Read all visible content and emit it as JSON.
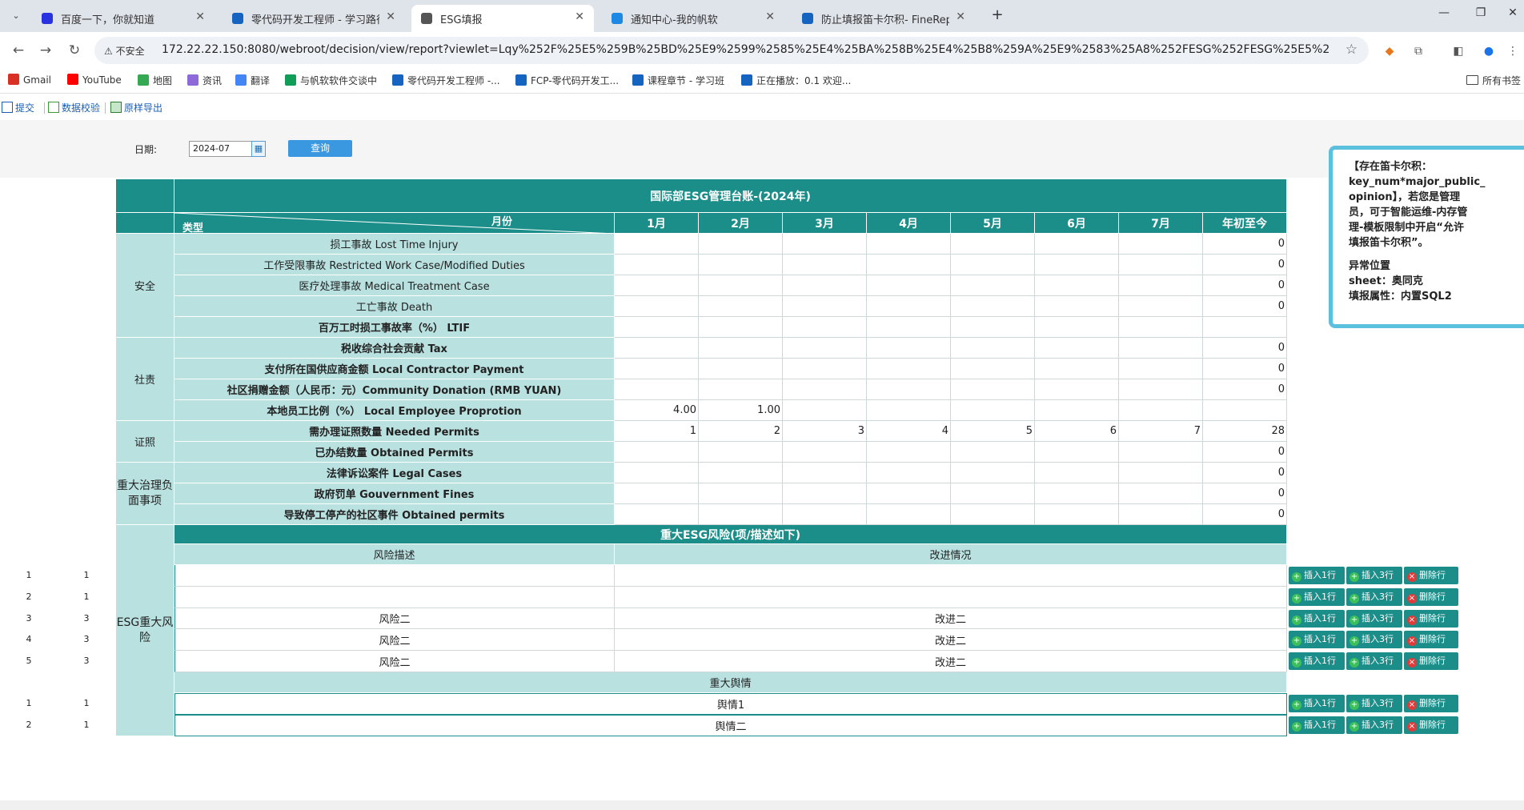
{
  "browser": {
    "tabs": [
      {
        "title": "百度一下，你就知道",
        "icon": "baidu-paw",
        "color": "#2932e1"
      },
      {
        "title": "零代码开发工程师 - 学习路径",
        "icon": "fanruan-f",
        "color": "#1565c0"
      },
      {
        "title": "ESG填报",
        "icon": "globe",
        "color": "#555555",
        "active": true
      },
      {
        "title": "通知中心-我的帆软",
        "icon": "fanruan-bars",
        "color": "#1e88e5"
      },
      {
        "title": "防止填报笛卡尔积- FineReport",
        "icon": "fanruan-f",
        "color": "#1565c0"
      }
    ],
    "address": {
      "security": "不安全",
      "url": "172.22.22.150:8080/webroot/decision/view/report?viewlet=Lqy%252F%25E5%259B%25BD%25E9%2599%2585%25E4%25BA%258B%25E4%25B8%259A%25E9%2583%25A8%252FESG%252FESG%25E5%25A1%25AB%25E6%258A%25A5.cpt"
    },
    "bookmarks": [
      "Gmail",
      "YouTube",
      "地图",
      "资讯",
      "翻译",
      "与帆软软件交谈中",
      "零代码开发工程师 -...",
      "FCP-零代码开发工...",
      "课程章节 - 学习班",
      "正在播放：0.1 欢迎..."
    ],
    "bookmarks_right": "所有书签"
  },
  "report_toolbar": {
    "submit": "提交",
    "verify": "数据校验",
    "export": "原样导出"
  },
  "params": {
    "date_label": "日期:",
    "date_value": "2024-07",
    "query_label": "查询"
  },
  "report": {
    "title": "国际部ESG管理台账-(2024年)",
    "corner_month": "月份",
    "corner_type": "类型",
    "months": [
      "1月",
      "2月",
      "3月",
      "4月",
      "5月",
      "6月",
      "7月"
    ],
    "ytd": "年初至今",
    "groups": {
      "safety": "安全",
      "social": "社责",
      "permits": "证照",
      "negative": "重大治理负面事项",
      "risk": "ESG重大风险"
    },
    "rows": [
      {
        "label": "损工事故 Lost Time Injury",
        "bold": false,
        "values": [
          "",
          "",
          "",
          "",
          "",
          "",
          ""
        ],
        "ytd": "0"
      },
      {
        "label": "工作受限事故 Restricted Work Case/Modified Duties",
        "bold": false,
        "values": [
          "",
          "",
          "",
          "",
          "",
          "",
          ""
        ],
        "ytd": "0"
      },
      {
        "label": "医疗处理事故 Medical Treatment Case",
        "bold": false,
        "values": [
          "",
          "",
          "",
          "",
          "",
          "",
          ""
        ],
        "ytd": "0"
      },
      {
        "label": "工亡事故 Death",
        "bold": false,
        "values": [
          "",
          "",
          "",
          "",
          "",
          "",
          ""
        ],
        "ytd": "0"
      },
      {
        "label": "百万工时损工事故率（%） LTIF",
        "bold": true,
        "values": [
          "",
          "",
          "",
          "",
          "",
          "",
          ""
        ],
        "ytd": ""
      },
      {
        "label": "税收综合社会贡献 Tax",
        "bold": true,
        "values": [
          "",
          "",
          "",
          "",
          "",
          "",
          ""
        ],
        "ytd": "0"
      },
      {
        "label": "支付所在国供应商金额 Local Contractor Payment",
        "bold": true,
        "values": [
          "",
          "",
          "",
          "",
          "",
          "",
          ""
        ],
        "ytd": "0"
      },
      {
        "label": "社区捐赠金额（人民币：元）Community Donation (RMB YUAN)",
        "bold": true,
        "values": [
          "",
          "",
          "",
          "",
          "",
          "",
          ""
        ],
        "ytd": "0"
      },
      {
        "label": "本地员工比例（%） Local Employee Proprotion",
        "bold": true,
        "values": [
          "4.00",
          "1.00",
          "",
          "",
          "",
          "",
          ""
        ],
        "ytd": ""
      },
      {
        "label": "需办理证照数量 Needed Permits",
        "bold": true,
        "values": [
          "1",
          "2",
          "3",
          "4",
          "5",
          "6",
          "7"
        ],
        "ytd": "28"
      },
      {
        "label": "已办结数量 Obtained Permits",
        "bold": true,
        "values": [
          "",
          "",
          "",
          "",
          "",
          "",
          ""
        ],
        "ytd": "0"
      },
      {
        "label": "法律诉讼案件 Legal Cases",
        "bold": true,
        "values": [
          "",
          "",
          "",
          "",
          "",
          "",
          ""
        ],
        "ytd": "0"
      },
      {
        "label": "政府罚单 Gouvernment Fines",
        "bold": true,
        "values": [
          "",
          "",
          "",
          "",
          "",
          "",
          ""
        ],
        "ytd": "0"
      },
      {
        "label": "导致停工停产的社区事件 Obtained permits",
        "bold": true,
        "values": [
          "",
          "",
          "",
          "",
          "",
          "",
          ""
        ],
        "ytd": "0"
      }
    ],
    "risk_header": "重大ESG风险(项/描述如下)",
    "risk_col_desc": "风险描述",
    "risk_col_improve": "改进情况",
    "risk_rows": [
      {
        "n1": "1",
        "n2": "1",
        "desc": "",
        "improve": ""
      },
      {
        "n1": "2",
        "n2": "1",
        "desc": "",
        "improve": ""
      },
      {
        "n1": "3",
        "n2": "3",
        "desc": "风险二",
        "improve": "改进二"
      },
      {
        "n1": "4",
        "n2": "3",
        "desc": "风险二",
        "improve": "改进二"
      },
      {
        "n1": "5",
        "n2": "3",
        "desc": "风险二",
        "improve": "改进二"
      }
    ],
    "opinion_header": "重大舆情",
    "opinion_rows": [
      {
        "n1": "1",
        "n2": "1",
        "text": "舆情1"
      },
      {
        "n1": "2",
        "n2": "1",
        "text": "舆情二"
      }
    ],
    "row_actions": {
      "insert1": "插入1行",
      "insert3": "插入3行",
      "delete": "删除行"
    }
  },
  "tooltip": {
    "lines": [
      "【存在笛卡尔积：",
      "key_num*major_public_",
      "opinion】，若您是管理",
      "员，可于智能运维-内存管",
      "理-模板限制中开启“允许",
      "填报笛卡尔积”。",
      "",
      "异常位置",
      "sheet：奥同克",
      "填报属性：内置SQL2"
    ]
  }
}
